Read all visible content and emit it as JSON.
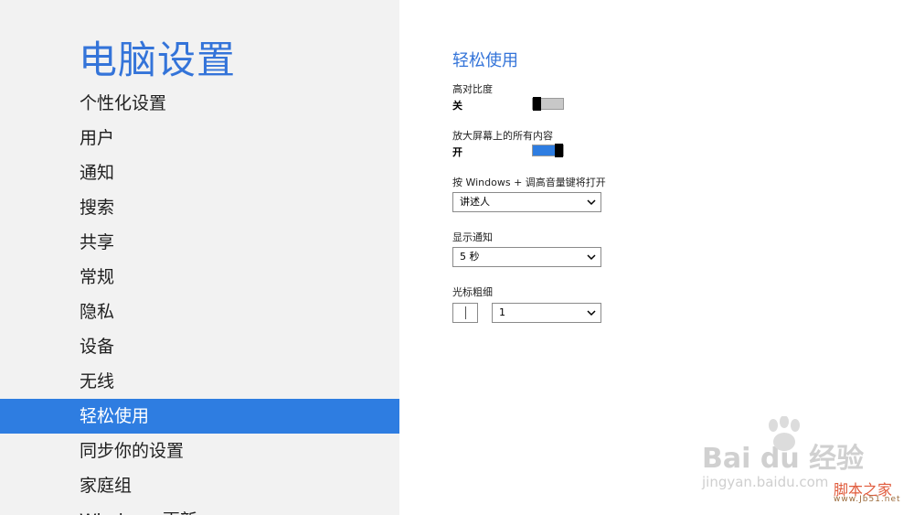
{
  "sidebar": {
    "title": "电脑设置",
    "items": [
      {
        "label": "个性化设置"
      },
      {
        "label": "用户"
      },
      {
        "label": "通知"
      },
      {
        "label": "搜索"
      },
      {
        "label": "共享"
      },
      {
        "label": "常规"
      },
      {
        "label": "隐私"
      },
      {
        "label": "设备"
      },
      {
        "label": "无线"
      },
      {
        "label": "轻松使用",
        "selected": true
      },
      {
        "label": "同步你的设置"
      },
      {
        "label": "家庭组"
      },
      {
        "label": "Windows 更新"
      }
    ]
  },
  "panel": {
    "title": "轻松使用",
    "high_contrast": {
      "label": "高对比度",
      "state": "关",
      "on": false
    },
    "zoom_all": {
      "label": "放大屏幕上的所有内容",
      "state": "开",
      "on": true
    },
    "shortcut": {
      "label": "按 Windows + 调高音量键将打开",
      "value": "讲述人"
    },
    "notification": {
      "label": "显示通知",
      "value": "5 秒"
    },
    "cursor": {
      "label": "光标粗细",
      "value": "1"
    }
  },
  "watermark": {
    "brand": "Bai du 经验",
    "sub": "jingyan.baidu.com",
    "site": "脚本之家",
    "site_url": "www.Jb51.net"
  },
  "colors": {
    "accent": "#2e7de1",
    "title": "#3474d9",
    "sidebar_bg": "#f2f2f2"
  }
}
